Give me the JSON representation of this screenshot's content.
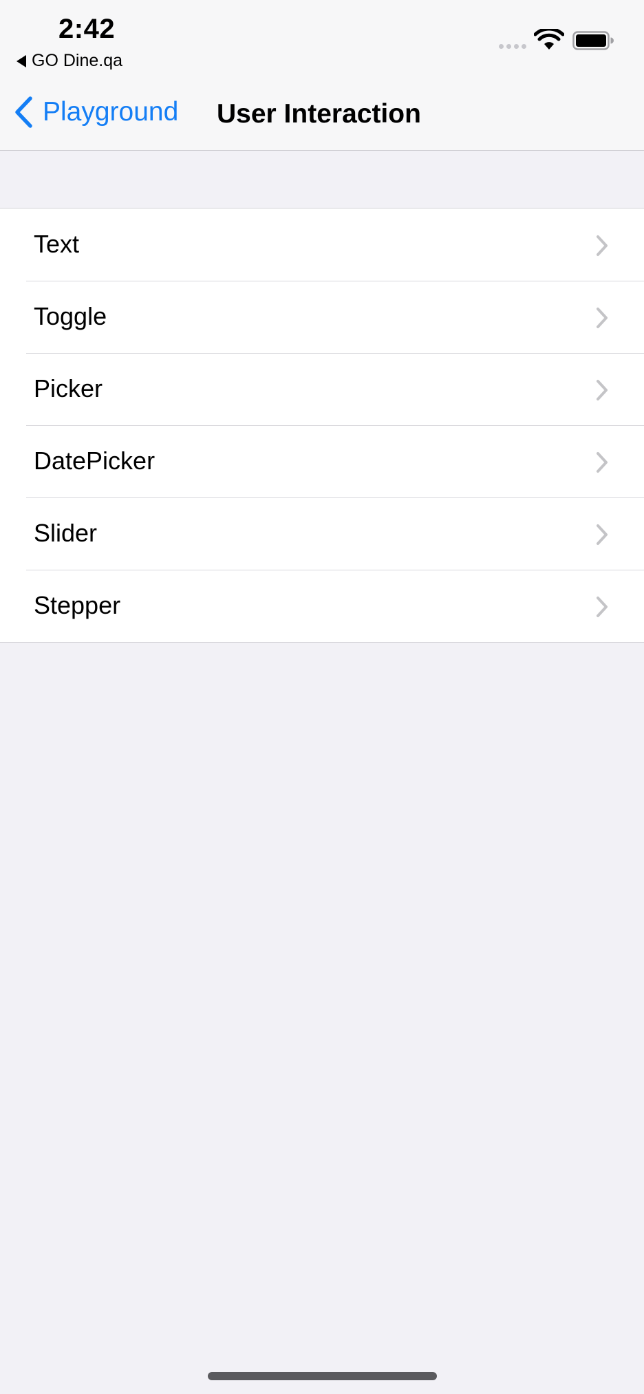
{
  "status_bar": {
    "time": "2:42",
    "back_app": "GO Dine.qa",
    "icons": [
      "cellular-signal-icon",
      "wifi-icon",
      "battery-icon"
    ]
  },
  "nav": {
    "back_label": "Playground",
    "title": "User Interaction"
  },
  "list": {
    "items": [
      {
        "label": "Text"
      },
      {
        "label": "Toggle"
      },
      {
        "label": "Picker"
      },
      {
        "label": "DatePicker"
      },
      {
        "label": "Slider"
      },
      {
        "label": "Stepper"
      }
    ]
  },
  "colors": {
    "accent": "#147ef5",
    "background": "#f2f1f6",
    "chevron": "#c4c4c7"
  }
}
